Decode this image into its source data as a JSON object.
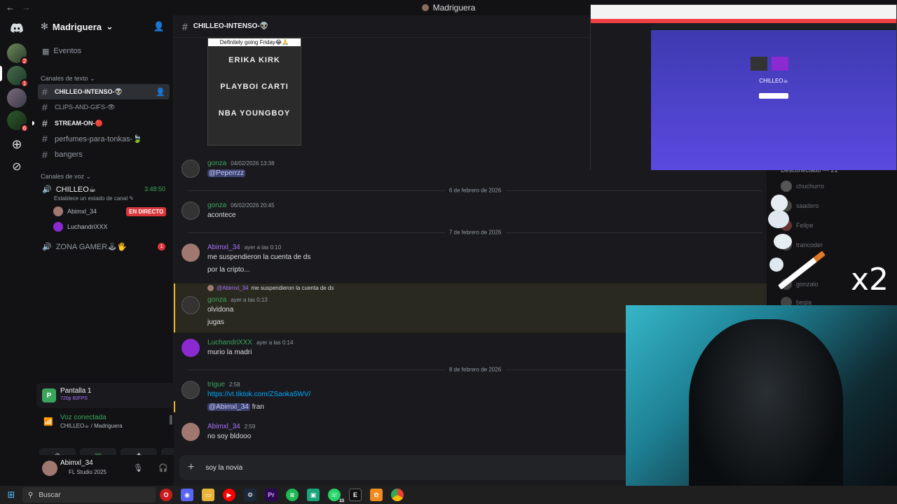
{
  "window": {
    "title": "Madriguera",
    "nav_back": "←",
    "nav_forward": "→"
  },
  "guild_badges": [
    "2",
    "1",
    "6"
  ],
  "server": {
    "name": "Madriguera",
    "events": "Eventos"
  },
  "categories": {
    "text": "Canales de texto",
    "voice": "Canales de voz"
  },
  "text_channels": [
    {
      "name": "CHILLEO-INTENSO-👽",
      "active": true
    },
    {
      "name": "CLIPS-AND-GIFS-👁",
      "active": false
    },
    {
      "name": "STREAM-ON-🔴",
      "active": false
    },
    {
      "name": "perfumes-para-tonkas-🍃",
      "active": false
    },
    {
      "name": "bangers",
      "active": false
    }
  ],
  "voice_channels": [
    {
      "name": "CHILLEO☕",
      "timer": "3:48:50",
      "status": "Establece un estado de canal"
    },
    {
      "name": "ZONA GAMER🕹🖐",
      "badge": "1"
    }
  ],
  "voice_users": [
    {
      "name": "Abimxl_34",
      "live": "EN DIRECTO"
    },
    {
      "name": "LuchandriXXX"
    }
  ],
  "screen_share": {
    "title": "Pantalla 1",
    "quality": "720p 60FPS"
  },
  "voice_conn": {
    "title": "Voz conectada",
    "sub": "CHILLEO☕ / Madriguera"
  },
  "user": {
    "name": "Abimxl_34",
    "activity": "FL Studio 2025"
  },
  "channel": {
    "name": "CHILLEO-INTENSO-👽"
  },
  "image_caption": "Definitely going Friday😂🙏",
  "poster_lines": [
    "ERIKA KIRK",
    "PLAYBOI CARTI",
    "NBA YOUNGBOY"
  ],
  "messages": [
    {
      "author": "gonza",
      "time": "04/02/2026 13:38",
      "lines": [
        "@Peperrzz"
      ],
      "color": "#3ba55c"
    },
    {
      "divider": "6 de febrero de 2026"
    },
    {
      "author": "gonza",
      "time": "06/02/2026 20:45",
      "lines": [
        "acontece"
      ],
      "color": "#3ba55c"
    },
    {
      "divider": "7 de febrero de 2026"
    },
    {
      "author": "Abimxl_34",
      "time": "ayer a las 0:10",
      "lines": [
        "me suspendieron la cuenta de ds",
        "por la cripto..."
      ],
      "color": "#a970ff"
    },
    {
      "reply_to": "@Abimxl_34",
      "reply_text": "me suspendieron la cuenta de ds",
      "author": "gonza",
      "time": "ayer a las 0:13",
      "lines": [
        "olvidona",
        "jugas"
      ],
      "color": "#3ba55c"
    },
    {
      "author": "LuchandriXXX",
      "time": "ayer a las 0:14",
      "lines": [
        "murio la madri"
      ],
      "color": "#3ba55c"
    },
    {
      "divider": "8 de febrero de 2026"
    },
    {
      "author": "trigue",
      "time": "2:58",
      "lines": [
        "https://vt.tiktok.com/ZSaoka5WV/"
      ],
      "mention": "@Abimxl_34",
      "mention_text": "fran",
      "color": "#3ba55c"
    },
    {
      "author": "Abimxl_34",
      "time": "2:59",
      "lines": [
        "no soy bldooo"
      ],
      "color": "#a970ff"
    }
  ],
  "composer": {
    "text": "soy la novia"
  },
  "overlay": {
    "disconnected": "Desconectado — 21",
    "members": [
      "chuchurro",
      "saadero",
      "Felipe",
      "trancoder",
      "gonzalo",
      "begia"
    ],
    "multiplier": "x2"
  },
  "mini_screen": {
    "channel": "CHILLEO☕"
  },
  "taskbar": {
    "search": "Buscar",
    "whatsapp_badge": "23"
  }
}
